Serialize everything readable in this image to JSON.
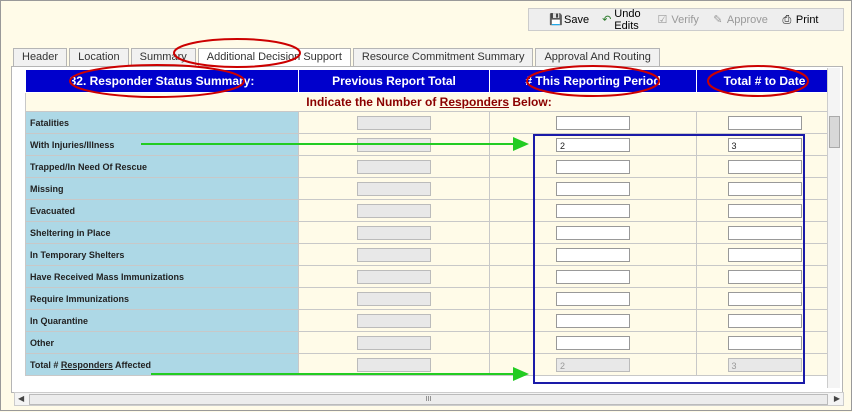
{
  "toolbar": {
    "save": "Save",
    "undo": "Undo Edits",
    "verify": "Verify",
    "approve": "Approve",
    "print": "Print",
    "menu": "▼"
  },
  "tabs": [
    "Header",
    "Location",
    "Summary",
    "Additional Decision Support",
    "Resource Commitment Summary",
    "Approval And Routing"
  ],
  "table": {
    "headers": [
      "32. Responder Status Summary:",
      "Previous Report Total",
      "# This Reporting Period",
      "Total # to Date"
    ],
    "instruction_pre": "Indicate the Number of ",
    "instruction_u": "Responders",
    "instruction_post": " Below:",
    "rows": [
      {
        "label": "Fatalities",
        "period": "",
        "total": ""
      },
      {
        "label": "With Injuries/Illness",
        "period": "2",
        "total": "3"
      },
      {
        "label": "Trapped/In Need Of Rescue",
        "period": "",
        "total": ""
      },
      {
        "label": "Missing",
        "period": "",
        "total": ""
      },
      {
        "label": "Evacuated",
        "period": "",
        "total": ""
      },
      {
        "label": "Sheltering in Place",
        "period": "",
        "total": ""
      },
      {
        "label": "In Temporary Shelters",
        "period": "",
        "total": ""
      },
      {
        "label": "Have Received Mass Immunizations",
        "period": "",
        "total": ""
      },
      {
        "label": "Require Immunizations",
        "period": "",
        "total": ""
      },
      {
        "label": "In Quarantine",
        "period": "",
        "total": ""
      },
      {
        "label": "Other",
        "period": "",
        "total": ""
      }
    ],
    "total_row": {
      "pre": "Total # ",
      "u": "Responders",
      "post": " Affected",
      "period": "2",
      "total": "3"
    }
  },
  "scroll": {
    "thumb": "III"
  }
}
